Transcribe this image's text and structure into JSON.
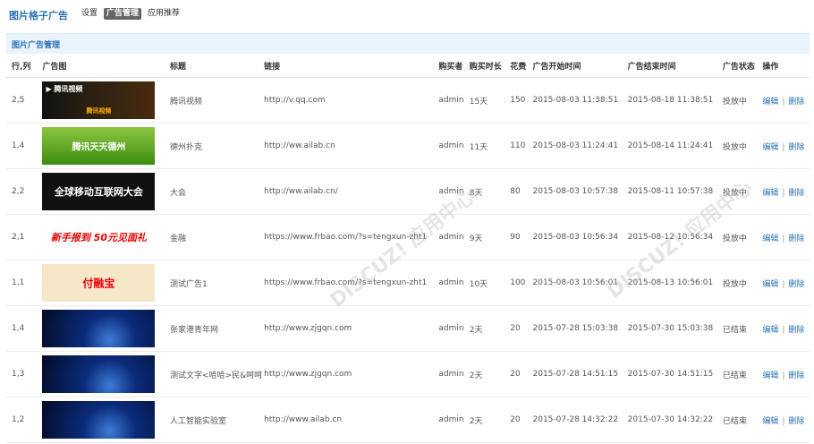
{
  "app": {
    "title": "图片格子广告"
  },
  "nav": {
    "items": [
      {
        "label": "设置",
        "active": false
      },
      {
        "label": "广告管理",
        "active": true
      },
      {
        "label": "应用推荐",
        "active": false
      }
    ]
  },
  "section": {
    "title": "图片广告管理"
  },
  "table": {
    "headers": [
      "行,列",
      "广告图",
      "标题",
      "链接",
      "购买者",
      "购买时长",
      "花费",
      "广告开始时间",
      "广告结束时间",
      "广告状态",
      "操作"
    ],
    "edit_label": "编辑",
    "delete_label": "删除",
    "separator": "|",
    "rows": [
      {
        "pos": "2,5",
        "img_caption": "腾讯视频",
        "title": "腾讯视频",
        "link": "http://v.qq.com",
        "buyer": "admin",
        "duration": "15天",
        "cost": "150",
        "start": "2015-08-03 11:38:51",
        "end": "2015-08-18 11:38:51",
        "status": "投放中",
        "status_type": "on"
      },
      {
        "pos": "1,4",
        "img_caption": "腾讯天天德州",
        "title": "德州扑克",
        "link": "http://ww.ailab.cn",
        "buyer": "admin",
        "duration": "11天",
        "cost": "110",
        "start": "2015-08-03 11:24:41",
        "end": "2015-08-14 11:24:41",
        "status": "投放中",
        "status_type": "on"
      },
      {
        "pos": "2,2",
        "img_caption": "全球移动互联网大会",
        "title": "大会",
        "link": "http://ww.ailab.cn/",
        "buyer": "admin",
        "duration": "8天",
        "cost": "80",
        "start": "2015-08-03 10:57:38",
        "end": "2015-08-11 10:57:38",
        "status": "投放中",
        "status_type": "on"
      },
      {
        "pos": "2,1",
        "img_caption": "新手报到 50元见面礼",
        "title": "金融",
        "link": "https://www.frbao.com/?s=tengxun-zht1",
        "buyer": "admin",
        "duration": "9天",
        "cost": "90",
        "start": "2015-08-03 10:56:34",
        "end": "2015-08-12 10:56:34",
        "status": "投放中",
        "status_type": "on"
      },
      {
        "pos": "1,1",
        "img_caption": "付融宝",
        "title": "测试广告1",
        "link": "https://www.frbao.com/?s=tengxun-zht1",
        "buyer": "admin",
        "duration": "10天",
        "cost": "100",
        "start": "2015-08-03 10:56:01",
        "end": "2015-08-13 10:56:01",
        "status": "投放中",
        "status_type": "on"
      },
      {
        "pos": "1,4",
        "img_caption": "",
        "title": "张家港青年网",
        "link": "http://www.zjgqn.com",
        "buyer": "admin",
        "duration": "2天",
        "cost": "20",
        "start": "2015-07-28 15:03:38",
        "end": "2015-07-30 15:03:38",
        "status": "已结束",
        "status_type": "off"
      },
      {
        "pos": "1,3",
        "img_caption": "",
        "title": "测试文字<哈哈>民&呵呵",
        "link": "http://www.zjgqn.com",
        "buyer": "admin",
        "duration": "2天",
        "cost": "20",
        "start": "2015-07-28 14:51:15",
        "end": "2015-07-30 14:51:15",
        "status": "已结束",
        "status_type": "off"
      },
      {
        "pos": "1,2",
        "img_caption": "",
        "title": "人工智能实验室",
        "link": "http://www.ailab.cn",
        "buyer": "admin",
        "duration": "2天",
        "cost": "20",
        "start": "2015-07-28 14:32:22",
        "end": "2015-07-30 14:32:22",
        "status": "已结束",
        "status_type": "off"
      }
    ]
  },
  "colors": {
    "accent": "#2b73b7",
    "active_status": "#27a000",
    "ended_status": "#e10000",
    "section_bg": "#e8f3fd"
  }
}
